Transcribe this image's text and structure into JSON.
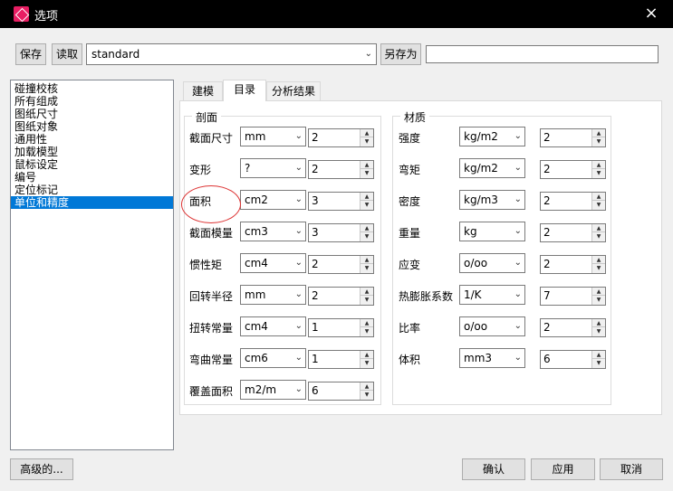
{
  "window": {
    "title": "选项",
    "close_icon": "×"
  },
  "toolbar": {
    "save_label": "保存",
    "load_label": "读取",
    "preset_value": "standard",
    "save_as_label": "另存为",
    "save_as_value": ""
  },
  "categories": [
    {
      "label": "碰撞校核"
    },
    {
      "label": "所有组成"
    },
    {
      "label": "图纸尺寸"
    },
    {
      "label": "图纸对象"
    },
    {
      "label": "通用性"
    },
    {
      "label": "加载模型"
    },
    {
      "label": "鼠标设定"
    },
    {
      "label": "编号"
    },
    {
      "label": "定位标记"
    },
    {
      "label": "单位和精度"
    }
  ],
  "tabs": [
    {
      "label": "建模"
    },
    {
      "label": "目录"
    },
    {
      "label": "分析结果"
    }
  ],
  "section_group": {
    "title": "剖面",
    "rows": [
      {
        "label": "截面尺寸",
        "unit": "mm",
        "value": "2"
      },
      {
        "label": "变形",
        "unit": "?",
        "value": "2"
      },
      {
        "label": "面积",
        "unit": "cm2",
        "value": "3"
      },
      {
        "label": "截面模量",
        "unit": "cm3",
        "value": "3"
      },
      {
        "label": "惯性矩",
        "unit": "cm4",
        "value": "2"
      },
      {
        "label": "回转半径",
        "unit": "mm",
        "value": "2"
      },
      {
        "label": "扭转常量",
        "unit": "cm4",
        "value": "1"
      },
      {
        "label": "弯曲常量",
        "unit": "cm6",
        "value": "1"
      },
      {
        "label": "覆盖面积",
        "unit": "m2/m",
        "value": "6"
      }
    ]
  },
  "material_group": {
    "title": "材质",
    "rows": [
      {
        "label": "强度",
        "unit": "kg/m2",
        "value": "2"
      },
      {
        "label": "弯矩",
        "unit": "kg/m2",
        "value": "2"
      },
      {
        "label": "密度",
        "unit": "kg/m3",
        "value": "2"
      },
      {
        "label": "重量",
        "unit": "kg",
        "value": "2"
      },
      {
        "label": "应变",
        "unit": "o/oo",
        "value": "2"
      },
      {
        "label": "热膨胀系数",
        "unit": "1/K",
        "value": "7"
      },
      {
        "label": "比率",
        "unit": "o/oo",
        "value": "2"
      },
      {
        "label": "体积",
        "unit": "mm3",
        "value": "6"
      }
    ]
  },
  "footer": {
    "advanced_label": "高级的...",
    "ok_label": "确认",
    "apply_label": "应用",
    "cancel_label": "取消"
  },
  "colors": {
    "selection": "#0078d7",
    "annotation": "#d33333"
  }
}
